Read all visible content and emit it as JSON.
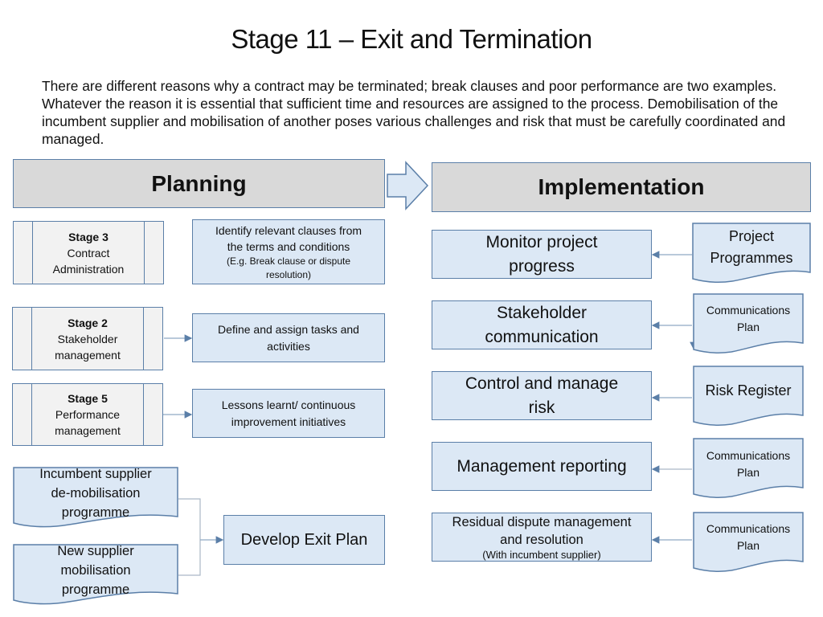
{
  "title": "Stage 11 – Exit and Termination",
  "intro": "There are different reasons why a contract may be terminated; break clauses and poor performance are two examples. Whatever the reason it is essential that sufficient time and resources are assigned to the process. Demobilisation of the incumbent supplier and mobilisation of another poses various challenges and risk that must be carefully coordinated and managed.",
  "colors": {
    "box_fill": "#dce8f5",
    "box_border": "#5b7fa8",
    "header_fill": "#d9d9d9",
    "stage_fill": "#f2f2f2",
    "connector": "#8fa9c4"
  },
  "planning": {
    "header": "Planning",
    "stages": [
      {
        "stage": "Stage 3",
        "label_line1": "Contract",
        "label_line2": "Administration"
      },
      {
        "stage": "Stage 2",
        "label_line1": "Stakeholder",
        "label_line2": "management"
      },
      {
        "stage": "Stage 5",
        "label_line1": "Performance",
        "label_line2": "management"
      }
    ],
    "actions": [
      {
        "line1": "Identify relevant clauses from",
        "line2": "the terms and conditions",
        "note1": "(E.g. Break clause or dispute",
        "note2": "resolution)"
      },
      {
        "line1": "Define and assign tasks and",
        "line2": "activities"
      },
      {
        "line1": "Lessons learnt/ continuous",
        "line2": "improvement initiatives"
      }
    ],
    "documents": [
      {
        "line1": "Incumbent supplier",
        "line2": "de-mobilisation",
        "line3": "programme"
      },
      {
        "line1": "New supplier",
        "line2": "mobilisation",
        "line3": "programme"
      }
    ],
    "exit_plan": "Develop Exit Plan"
  },
  "implementation": {
    "header": "Implementation",
    "activities": [
      {
        "line1": "Monitor project",
        "line2": "progress"
      },
      {
        "line1": "Stakeholder",
        "line2": "communication"
      },
      {
        "line1": "Control and manage",
        "line2": "risk"
      },
      {
        "line1": "Management reporting"
      },
      {
        "line1": "Residual dispute management",
        "line2": "and resolution",
        "note": "(With incumbent supplier)"
      }
    ],
    "inputs": [
      {
        "line1": "Project",
        "line2": "Programmes"
      },
      {
        "line1": "Communications",
        "line2": "Plan"
      },
      {
        "line1": "Risk Register"
      },
      {
        "line1": "Communications",
        "line2": "Plan"
      },
      {
        "line1": "Communications",
        "line2": "Plan"
      }
    ]
  }
}
